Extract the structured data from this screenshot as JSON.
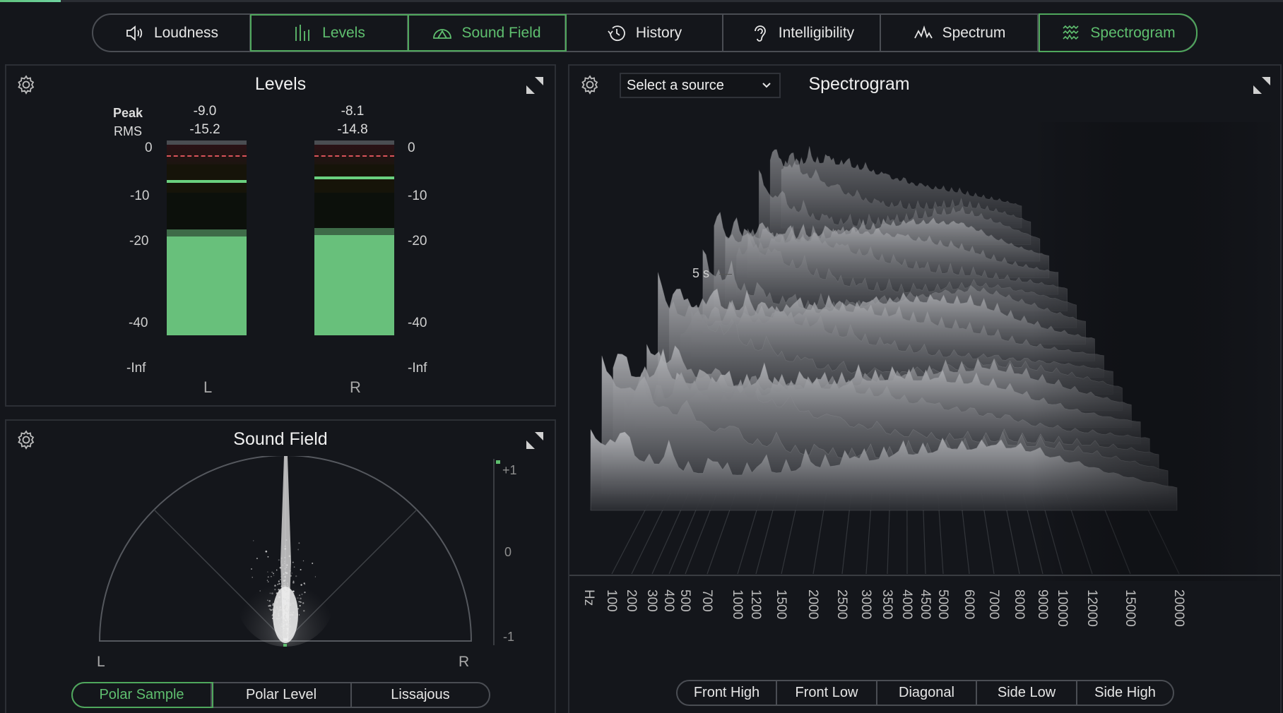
{
  "tabs": [
    {
      "label": "Loudness",
      "icon": "speaker-icon",
      "active": false
    },
    {
      "label": "Levels",
      "icon": "level-bars-icon",
      "active": true
    },
    {
      "label": "Sound Field",
      "icon": "sound-field-icon",
      "active": true
    },
    {
      "label": "History",
      "icon": "history-icon",
      "active": false
    },
    {
      "label": "Intelligibility",
      "icon": "ear-icon",
      "active": false
    },
    {
      "label": "Spectrum",
      "icon": "spectrum-icon",
      "active": false
    },
    {
      "label": "Spectrogram",
      "icon": "spectrogram-icon",
      "active": true
    }
  ],
  "levels": {
    "title": "Levels",
    "peak_label": "Peak",
    "rms_label": "RMS",
    "left": {
      "channel": "L",
      "peak": "-9.0",
      "rms": "-15.2",
      "peak_db": -9.0,
      "rms_db": -15.2
    },
    "right": {
      "channel": "R",
      "peak": "-8.1",
      "rms": "-14.8",
      "peak_db": -8.1,
      "rms_db": -14.8
    },
    "scale": [
      "0",
      "-10",
      "-20",
      "-40",
      "-Inf"
    ],
    "colors": {
      "fill": "#68c07b",
      "peak_line": "#6ad07f",
      "clip_line": "#d9535a"
    }
  },
  "soundfield": {
    "title": "Sound Field",
    "left_label": "L",
    "right_label": "R",
    "correlation_scale": [
      "+1",
      "0",
      "-1"
    ],
    "correlation_value": 1.0,
    "modes": [
      {
        "label": "Polar Sample",
        "active": true
      },
      {
        "label": "Polar Level",
        "active": false
      },
      {
        "label": "Lissajous",
        "active": false
      }
    ]
  },
  "spectrogram": {
    "title": "Spectrogram",
    "source_select": "Select a source",
    "time_label": "5 s",
    "freq_unit": "Hz",
    "freq_ticks": [
      "100",
      "200",
      "300",
      "400",
      "500",
      "700",
      "1000",
      "1200",
      "1500",
      "2000",
      "2500",
      "3000",
      "3500",
      "4000",
      "4500",
      "5000",
      "6000",
      "7000",
      "8000",
      "9000",
      "10000",
      "12000",
      "15000",
      "20000"
    ],
    "views": [
      {
        "label": "Front High"
      },
      {
        "label": "Front Low"
      },
      {
        "label": "Diagonal"
      },
      {
        "label": "Side Low"
      },
      {
        "label": "Side High"
      }
    ]
  },
  "accent_color": "#5fbf6f"
}
